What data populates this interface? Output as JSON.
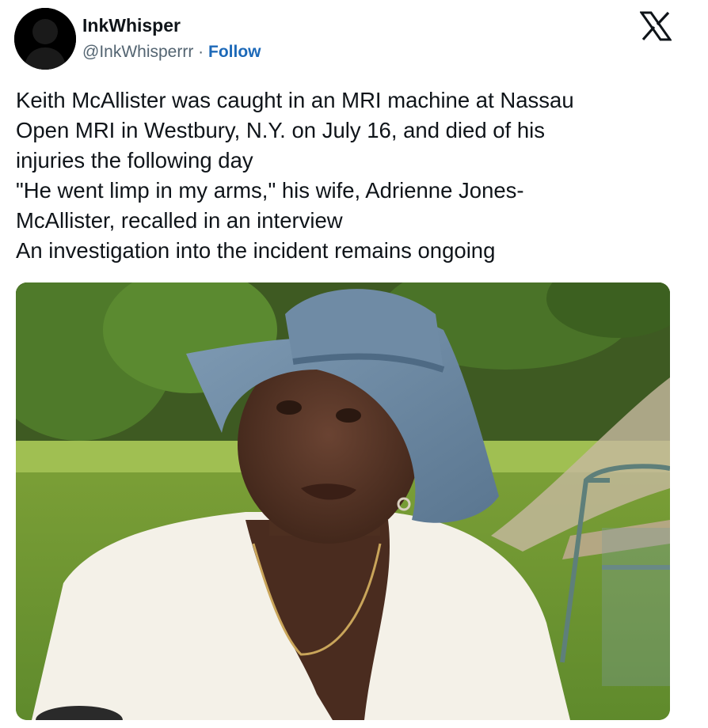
{
  "tweet": {
    "display_name": "InkWhisper",
    "handle": "@InkWhisperrr",
    "separator": " · ",
    "follow_label": "Follow",
    "platform_icon": "x-logo-icon",
    "text_lines": [
      "Keith McAllister was caught in an MRI machine at Nassau",
      "Open MRI in Westbury, N.Y. on July 16, and died of his",
      "injuries the following day",
      "\"He went limp in my arms,\" his wife, Adrienne Jones-",
      "McAllister, recalled in an interview",
      "An investigation into the incident remains ongoing"
    ],
    "media": {
      "kind": "photo",
      "subject_icon": "woman-in-hat-photo"
    }
  },
  "colors": {
    "link": "#1d69b8",
    "text": "#0f1419",
    "secondary": "#536471"
  }
}
